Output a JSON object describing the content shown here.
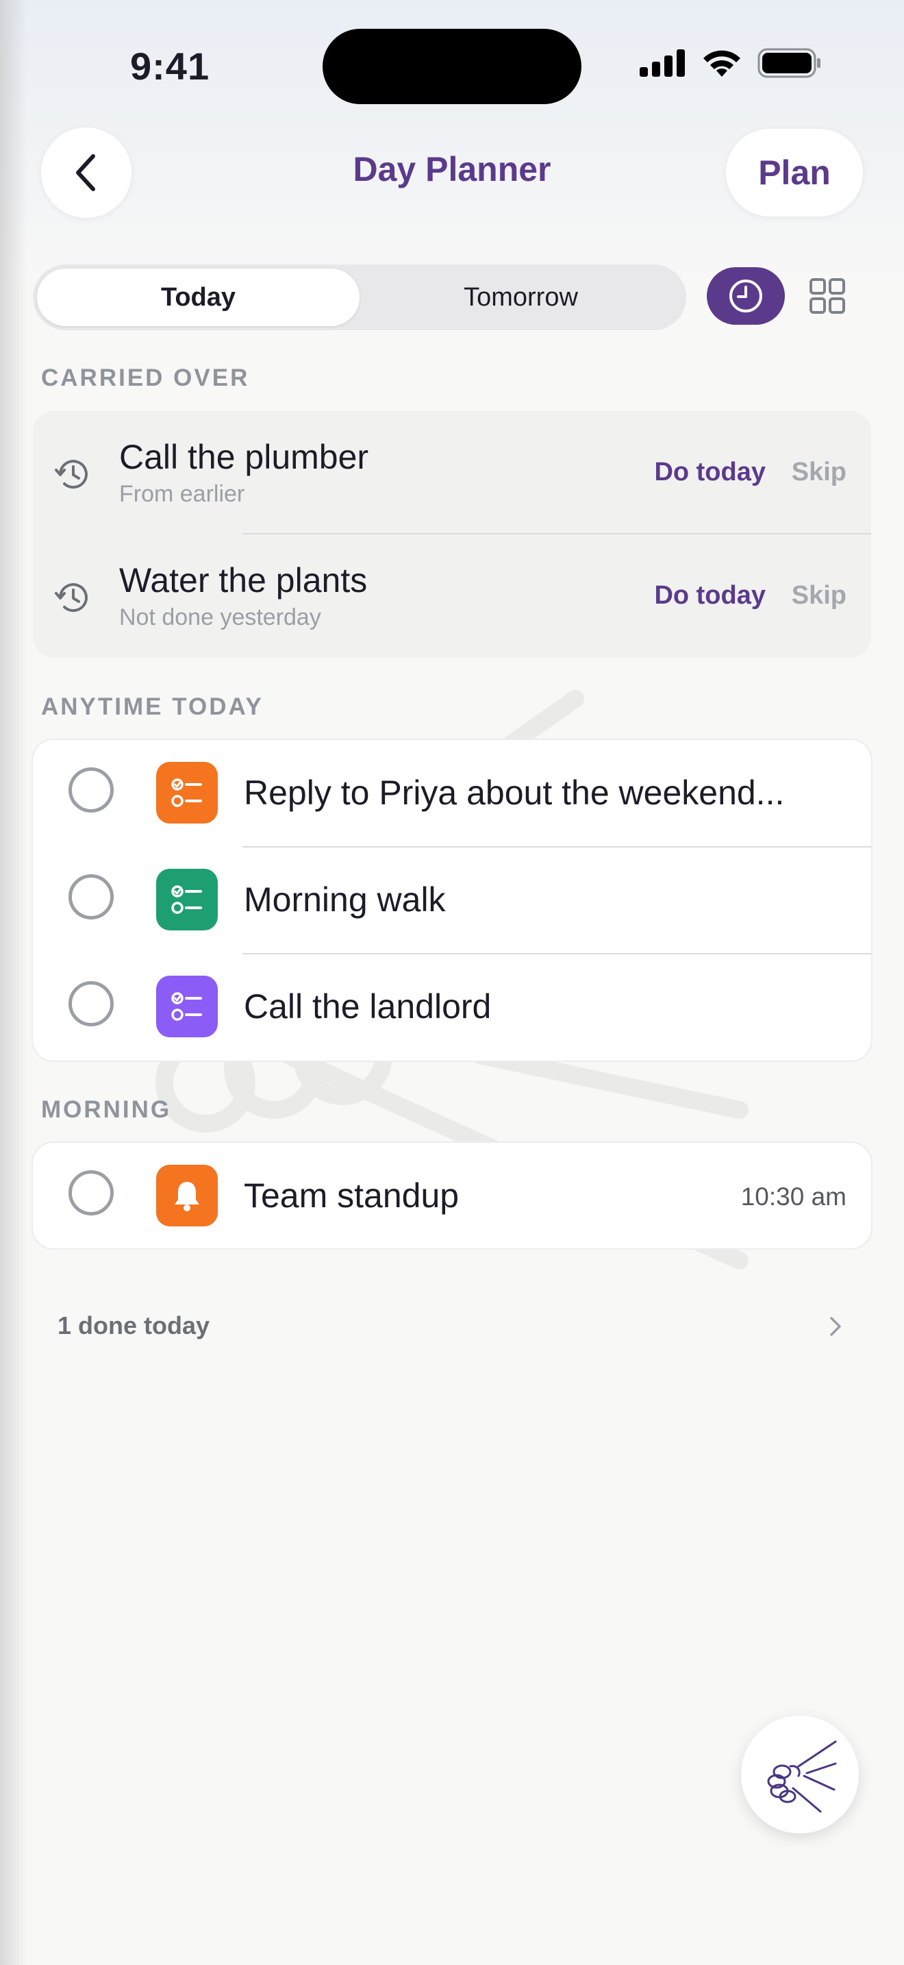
{
  "status_bar": {
    "time": "9:41"
  },
  "header": {
    "title": "Day Planner",
    "plan_label": "Plan"
  },
  "segmented": {
    "today_label": "Today",
    "tomorrow_label": "Tomorrow",
    "selected": "Today"
  },
  "view_toggle": {
    "active": "clock-icon",
    "inactive": "grid-icon",
    "accent": "#5b3a8c"
  },
  "carried_over": {
    "label": "CARRIED OVER",
    "items": [
      {
        "title": "Call the plumber",
        "subtitle": "From earlier",
        "do_today": "Do today",
        "skip": "Skip"
      },
      {
        "title": "Water the plants",
        "subtitle": "Not done yesterday",
        "do_today": "Do today",
        "skip": "Skip"
      }
    ]
  },
  "anytime_today": {
    "label": "ANYTIME TODAY",
    "items": [
      {
        "title": "Reply to Priya about the weekend...",
        "icon": "checklist-icon",
        "color": "#f47420"
      },
      {
        "title": "Morning walk",
        "icon": "checklist-icon",
        "color": "#1e9f72"
      },
      {
        "title": "Call the landlord",
        "icon": "checklist-icon",
        "color": "#8b5cf6"
      }
    ]
  },
  "morning": {
    "label": "MORNING",
    "items": [
      {
        "title": "Team standup",
        "time": "10:30 am",
        "icon": "bell-icon",
        "color": "#f47420"
      }
    ]
  },
  "done_summary": {
    "label": "1 done today"
  },
  "fab": {
    "icon": "handshake-icon"
  }
}
